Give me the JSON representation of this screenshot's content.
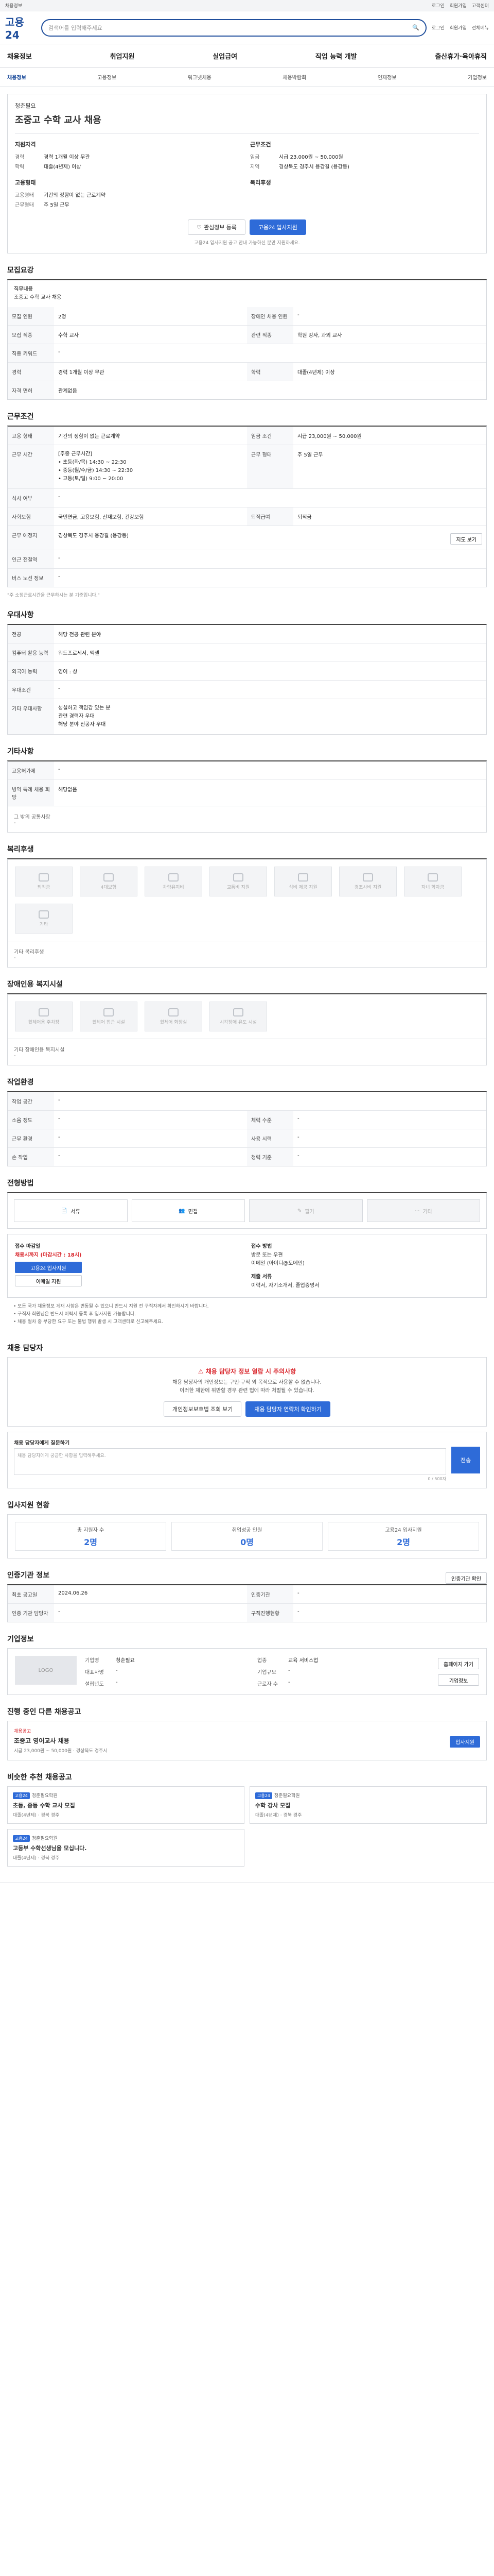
{
  "topbar": {
    "left": "채용정보",
    "right": [
      "로그인",
      "회원가입",
      "고객센터"
    ]
  },
  "header": {
    "logo": "고용24",
    "search_placeholder": "검색어를 입력해주세요",
    "links": [
      "로그인",
      "회원가입",
      "전체메뉴"
    ]
  },
  "gnb": [
    "채용정보",
    "취업지원",
    "실업급여",
    "직업 능력 개발",
    "출산휴가·육아휴직"
  ],
  "lnb": [
    "채용정보",
    "고용정보",
    "워크넷채용",
    "채용박람회",
    "인재정보",
    "기업정보"
  ],
  "summary": {
    "company": "청춘필요",
    "title": "조중고 수학 교사 채용",
    "left_title": "지원자격",
    "left": [
      {
        "k": "경력",
        "v": "경력 1개월 이상 무관"
      },
      {
        "k": "학력",
        "v": "대졸(4년제) 이상"
      }
    ],
    "left_title2": "고용형태",
    "left2": [
      {
        "k": "고용형태",
        "v": "기간의 정함이 없는 근로계약"
      },
      {
        "k": "근무형태",
        "v": "주 5일 근무"
      }
    ],
    "right_title": "근무조건",
    "right": [
      {
        "k": "임금",
        "v": "시급 23,000원 ~ 50,000원"
      },
      {
        "k": "지역",
        "v": "경상북도 경주시 용강길 (용강동)"
      }
    ],
    "right_title2": "복리후생",
    "btn_save": "관심정보 등록",
    "btn_apply": "고용24 입사지원",
    "notice": "고용24 입사지원 공고 안내 가능하신 분만 지원하세요."
  },
  "recruit": {
    "title": "모집요강",
    "job_title": "직무내용",
    "job_desc": "조중고 수학 교사 채용",
    "rows": [
      [
        "모집 인원",
        "2명",
        "장애인 채용 인원",
        "-"
      ],
      [
        "모집 직종",
        "수학 교사",
        "관련 직종",
        "학원 강사, 과외 교사"
      ],
      [
        "직종 키워드",
        "-",
        "",
        ""
      ],
      [
        "경력",
        "경력 1개월 이상 무관",
        "학력",
        "대졸(4년제) 이상"
      ],
      [
        "자격 면허",
        "관계없음",
        "",
        ""
      ]
    ]
  },
  "work": {
    "title": "근무조건",
    "rows": [
      [
        "고용 형태",
        "기간의 정함이 없는 근로계약",
        "임금 조건",
        "시급 23,000원 ~ 50,000원"
      ],
      [
        "근무 시간",
        "",
        "근무 형태",
        "주 5일 근무"
      ],
      [
        "식사 여부",
        "-",
        "",
        ""
      ],
      [
        "사회보험",
        "국민연금, 고용보험, 산재보험, 건강보험",
        "퇴직급여",
        "퇴직금"
      ],
      [
        "근무 예정지",
        "경상북도 경주시 용강길 (용강동)",
        "",
        ""
      ],
      [
        "인근 전철역",
        "-",
        "",
        ""
      ],
      [
        "버스 노선 정보",
        "-",
        "",
        ""
      ]
    ],
    "hours": "[주중 근무시간]\n• 초등(화/목) 14:30 ~ 22:30\n• 중등(월/수/금) 14:30 ~ 22:30\n• 고등(토/일) 9:00 ~ 20:00",
    "map_btn": "지도 보기",
    "note": "\"주 소정근로시간을 근무하시는 분 기준입니다.\""
  },
  "welfare_cond": {
    "title": "우대사항",
    "rows": [
      [
        "전공",
        "해당 전공 관련 분야"
      ],
      [
        "컴퓨터 활용 능력",
        "워드프로세서, 엑셀"
      ],
      [
        "외국어 능력",
        "영어 : 상"
      ],
      [
        "우대조건",
        "-"
      ],
      [
        "기타 우대사항",
        "성실하고 책임감 있는 분\n관련 경력자 우대\n해당 분야 전공자 우대"
      ]
    ]
  },
  "other": {
    "title": "기타사항",
    "rows": [
      [
        "고용허가제",
        "-"
      ],
      [
        "병역 특례 채용 희망",
        "해당없음"
      ]
    ],
    "extra_label": "그 밖의 공통사항",
    "extra": "-"
  },
  "benefit": {
    "title": "복리후생",
    "items": [
      "퇴직금",
      "4대보험",
      "차량유지비",
      "교통비 지원",
      "식비 제공 지원",
      "경조사비 지원",
      "자녀 학자금",
      "기타"
    ],
    "other_label": "기타 복리후생",
    "other": "-"
  },
  "disabled": {
    "title": "장애인용 복지시설",
    "items": [
      "휠체어용 주차장",
      "휠체어 접근 시설",
      "휠체어 화장실",
      "시각장애 유도 시설"
    ],
    "other_label": "기타 장애인용 복지시설",
    "other": "-"
  },
  "env": {
    "title": "작업환경",
    "rows": [
      [
        "작업 공간",
        "-",
        "",
        ""
      ],
      [
        "소음 정도",
        "-",
        "체력 수준",
        "-"
      ],
      [
        "근무 환경",
        "-",
        "사용 시력",
        "-"
      ],
      [
        "손 작업",
        "-",
        "청력 기준",
        "-"
      ]
    ]
  },
  "apply_method": {
    "title": "전형방법",
    "methods": [
      "서류",
      "면접",
      "필기",
      "기타"
    ],
    "deadline_label": "접수 마감일",
    "deadline": "채용시까지 (마감시간 : 18시)",
    "apply_btn": "고용24 입사지원",
    "email_btn": "이메일 지원",
    "method_label": "접수 방법",
    "method": "방문 또는 우편\n이메일 (아이디@도메인)",
    "doc_label": "제출 서류",
    "doc": "이력서, 자기소개서, 졸업증명서"
  },
  "notices": [
    "모든 국가 채용정보 게재 사항은 변동될 수 있으니 반드시 지원 전 구직자께서 확인하시기 바랍니다.",
    "구직자 회원님은 반드시 이력서 등록 후 입사지원 가능합니다.",
    "채용 절차 중 부당한 요구 또는 불법 행위 발생 시 고객센터로 신고해주세요."
  ],
  "manager": {
    "title": "채용 담당자",
    "alert_title": "채용 담당자 정보 열람 시 주의사항",
    "alert_text": "채용 담당자의 개인정보는 구인·구직 외 목적으로 사용할 수 없습니다.\n이러한 제한에 위반할 경우 관련 법에 따라 처벌될 수 있습니다.",
    "btn_view": "개인정보보호법 조회 보기",
    "btn_phone": "채용 담당자 연락처 확인하기",
    "qa_label": "채용 담당자에게 질문하기",
    "qa_placeholder": "채용 담당자에게 궁금한 사항을 입력해주세요.",
    "qa_btn": "전송",
    "qa_count": "0 / 500자"
  },
  "stats": {
    "title": "입사지원 현황",
    "items": [
      {
        "label": "총 지원자 수",
        "value": "2명"
      },
      {
        "label": "취업성공 인원",
        "value": "0명"
      },
      {
        "label": "고용24 입사지원",
        "value": "2명"
      }
    ]
  },
  "cert": {
    "title": "인증기관 정보",
    "btn": "인증기관 확인",
    "rows": [
      [
        "최초 공고일",
        "2024.06.26",
        "인증기관",
        "-"
      ],
      [
        "인증 기관 담당자",
        "-",
        "구직진행현황",
        "-"
      ]
    ]
  },
  "company": {
    "title": "기업정보",
    "logo_alt": "LOGO",
    "rows": [
      [
        "기업명",
        "청춘필요",
        "업종",
        "교육 서비스업"
      ],
      [
        "대표자명",
        "-",
        "기업규모",
        "-"
      ],
      [
        "설립년도",
        "-",
        "근로자 수",
        "-"
      ]
    ],
    "btn_home": "홈페이지 가기",
    "btn_info": "기업정보"
  },
  "recruitments": {
    "title": "진행 중인 다른 채용공고",
    "card": {
      "label": "채용공고",
      "title": "조중고 영어교사 채용",
      "detail": "시급 23,000원 ~ 50,000원 · 경상북도 경주시",
      "btn": "입사지원"
    }
  },
  "similar": {
    "title": "비슷한 추천 채용공고",
    "cards": [
      {
        "tag": "고용24",
        "co": "청춘필요학원",
        "title": "초등, 중등 수학 교사 모집",
        "meta": "대졸(4년제) · 경북 경주"
      },
      {
        "tag": "고용24",
        "co": "청춘필요학원",
        "title": "수학 강사 모집",
        "meta": "대졸(4년제) · 경북 경주"
      },
      {
        "tag": "고용24",
        "co": "청춘필요학원",
        "title": "고등부 수학선생님을 모십니다.",
        "meta": "대졸(4년제) · 경북 경주"
      }
    ]
  }
}
